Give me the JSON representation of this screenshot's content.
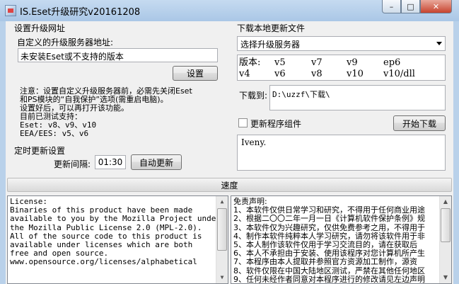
{
  "window": {
    "title": "IS.Eset升级研究v20161208",
    "min_label": "–",
    "max_label": "□",
    "close_label": "✕"
  },
  "upgrade_site": {
    "group_title": "设置升级网址",
    "custom_label": "自定义的升级服务器地址:",
    "custom_value": "未安装Eset或不支持的版本",
    "set_button": "设置",
    "notes": [
      "注意：设置自定义升级服务器前，必需先关闭Eset",
      "和PS模块的“自我保护”选项(需重启电脑)。",
      "设置好后，可以再打开该功能。",
      "目前已测试支持：",
      "Eset: v8、v9、v10",
      "EEA/EES:  v5、v6"
    ]
  },
  "scheduled_update": {
    "group_title": "定时更新设置",
    "interval_label": "更新间隔:",
    "interval_value": "01:30",
    "auto_update_button": "自动更新"
  },
  "local_download": {
    "group_title": "下载本地更新文件",
    "server_select": "选择升级服务器",
    "version_label": "版本:",
    "versions_row1": [
      "v5",
      "v7",
      "v9",
      "ep6"
    ],
    "versions_row2": [
      "v4",
      "v6",
      "v8",
      "v10",
      "v10/dll"
    ],
    "download_to_label": "下载到:",
    "download_path": "D:\\uzzf\\下载\\",
    "update_components_label": "更新程序组件",
    "start_download_button": "开始下载",
    "log_text": "Iveny."
  },
  "speed_label": "速度",
  "license_text": [
    "License:",
    "Binaries of this product have been made",
    "available to you by the Mozilla Project under",
    "the Mozilla Public License 2.0 (MPL-2.0).",
    "",
    "All of the source code to this product is",
    "available under licenses which are both",
    "free and open source.",
    "",
    "www.opensource.org/licenses/alphabetical"
  ],
  "disclaimer_text": [
    "免责声明:",
    "1、本软件仅供日常学习和研究，不得用于任何商业用途",
    "2、根据二〇〇二年一月一日《计算机软件保护条例》规",
    "3、本软件仅为兴趣研究，仅供免费参考之用，不得用于",
    "4、制作本软件纯粹本人学习研究，请勿将该软件用于非",
    "5、本人制作该软件仅用于学习交流目的，请在获取后",
    "6、本人不承担由于安装、使用该程序对您计算机所产生",
    "7、本程序由本人提取并参照官方资源加工制作，源资",
    "8、软件仅限在中国大陆地区测试，严禁在其他任何地区",
    "9、任何未经作者同意对本程序进行的修改请见左边声明"
  ]
}
